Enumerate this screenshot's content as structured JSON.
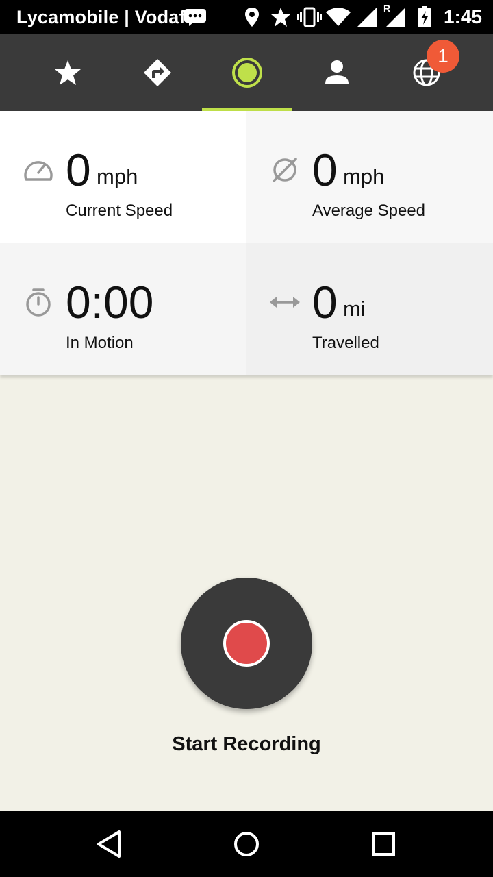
{
  "status_bar": {
    "carrier": "Lycamobile | Vodaf",
    "time": "1:45",
    "icons": [
      "message-icon",
      "location-icon",
      "star-icon",
      "vibrate-icon",
      "wifi-icon",
      "signal-icon",
      "roaming-signal-icon",
      "battery-charging-icon"
    ],
    "roaming_letter": "R"
  },
  "tabs": [
    {
      "name": "favorites",
      "icon": "star-icon"
    },
    {
      "name": "routes",
      "icon": "directions-icon"
    },
    {
      "name": "record",
      "icon": "record-circle-icon",
      "active": true
    },
    {
      "name": "profile",
      "icon": "person-icon"
    },
    {
      "name": "explore",
      "icon": "globe-icon",
      "badge": "1"
    }
  ],
  "stats": {
    "current_speed": {
      "value": "0",
      "unit": "mph",
      "label": "Current Speed",
      "icon": "speedometer-icon"
    },
    "average_speed": {
      "value": "0",
      "unit": "mph",
      "label": "Average Speed",
      "icon": "average-icon"
    },
    "in_motion": {
      "value": "0:00",
      "unit": "",
      "label": "In Motion",
      "icon": "stopwatch-icon"
    },
    "travelled": {
      "value": "0",
      "unit": "mi",
      "label": "Travelled",
      "icon": "arrows-horizontal-icon"
    }
  },
  "record": {
    "label": "Start Recording"
  },
  "colors": {
    "tab_bar": "#3a3a3a",
    "accent": "#bfe04a",
    "badge": "#f05a37",
    "record_dot": "#e04a4b",
    "background": "#f2f1e7"
  },
  "nav_bar": {
    "icons": [
      "back-icon",
      "home-icon",
      "recents-icon"
    ]
  }
}
